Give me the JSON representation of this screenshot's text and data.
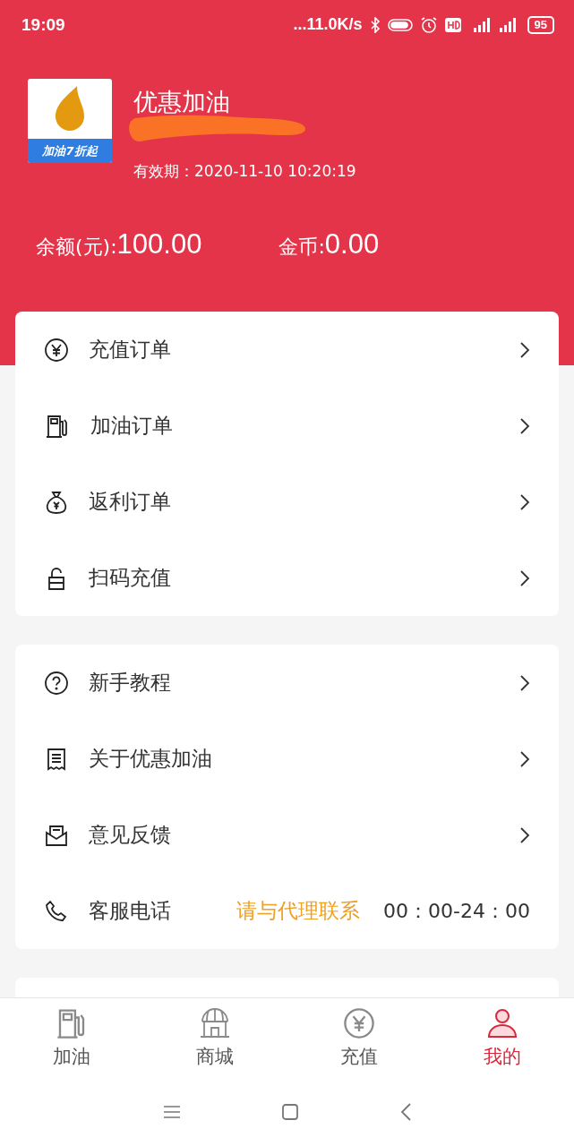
{
  "status_bar": {
    "time": "19:09",
    "network_speed": "...11.0K/s",
    "battery": "95"
  },
  "profile": {
    "name": "优惠加油",
    "logo_text": "加油7折起",
    "validity": "有效期：2020-11-10 10:20:19"
  },
  "balances": [
    {
      "label": "余额(元):",
      "value": "100.00"
    },
    {
      "label": "金币:",
      "value": "0.00"
    }
  ],
  "menu_groups": [
    {
      "items": [
        {
          "kind": "link",
          "label": "充值订单"
        },
        {
          "kind": "link",
          "label": "加油订单"
        },
        {
          "kind": "link",
          "label": "返利订单"
        },
        {
          "kind": "link",
          "label": "扫码充值"
        }
      ]
    },
    {
      "items": [
        {
          "kind": "link",
          "label": "新手教程"
        },
        {
          "kind": "link",
          "label": "关于优惠加油"
        },
        {
          "kind": "link",
          "label": "意见反馈"
        },
        {
          "kind": "phone",
          "label": "客服电话",
          "note": "请与代理联系",
          "hours": "00：00-24：00"
        }
      ]
    }
  ],
  "tab_bar": [
    {
      "label": "加油",
      "selected": false
    },
    {
      "label": "商城",
      "selected": false
    },
    {
      "label": "充值",
      "selected": false
    },
    {
      "label": "我的",
      "selected": true
    }
  ]
}
